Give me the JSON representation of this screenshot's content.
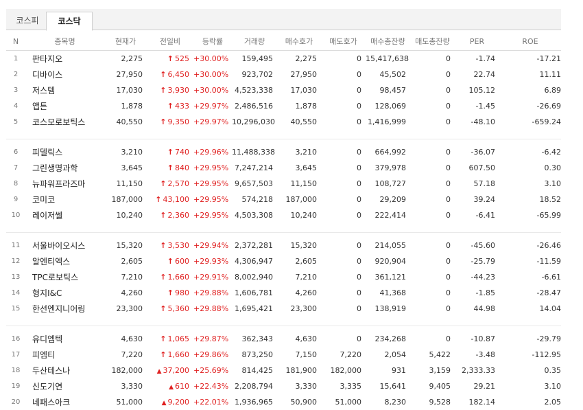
{
  "tabs": [
    {
      "label": "코스피"
    },
    {
      "label": "코스닥"
    }
  ],
  "columns": [
    "N",
    "종목명",
    "현재가",
    "전일비",
    "등락률",
    "거래량",
    "매수호가",
    "매도호가",
    "매수총잔량",
    "매도총잔량",
    "PER",
    "ROE"
  ],
  "rows": [
    {
      "n": "1",
      "name": "판타지오",
      "price": "2,275",
      "arrow": "up-arrow",
      "change": "525",
      "rate": "+30.00%",
      "volume": "159,495",
      "bid": "2,275",
      "ask": "0",
      "bid_total": "15,417,638",
      "ask_total": "0",
      "per": "-1.74",
      "roe": "-17.21"
    },
    {
      "n": "2",
      "name": "디바이스",
      "price": "27,950",
      "arrow": "up-arrow",
      "change": "6,450",
      "rate": "+30.00%",
      "volume": "923,702",
      "bid": "27,950",
      "ask": "0",
      "bid_total": "45,502",
      "ask_total": "0",
      "per": "22.74",
      "roe": "11.11"
    },
    {
      "n": "3",
      "name": "저스템",
      "price": "17,030",
      "arrow": "up-arrow",
      "change": "3,930",
      "rate": "+30.00%",
      "volume": "4,523,338",
      "bid": "17,030",
      "ask": "0",
      "bid_total": "98,457",
      "ask_total": "0",
      "per": "105.12",
      "roe": "6.89"
    },
    {
      "n": "4",
      "name": "앱튼",
      "price": "1,878",
      "arrow": "up-arrow",
      "change": "433",
      "rate": "+29.97%",
      "volume": "2,486,516",
      "bid": "1,878",
      "ask": "0",
      "bid_total": "128,069",
      "ask_total": "0",
      "per": "-1.45",
      "roe": "-26.69"
    },
    {
      "n": "5",
      "name": "코스모로보틱스",
      "price": "40,550",
      "arrow": "up-arrow",
      "change": "9,350",
      "rate": "+29.97%",
      "volume": "10,296,030",
      "bid": "40,550",
      "ask": "0",
      "bid_total": "1,416,999",
      "ask_total": "0",
      "per": "-48.10",
      "roe": "-659.24"
    },
    {
      "n": "6",
      "name": "피델릭스",
      "price": "3,210",
      "arrow": "up-arrow",
      "change": "740",
      "rate": "+29.96%",
      "volume": "11,488,338",
      "bid": "3,210",
      "ask": "0",
      "bid_total": "664,992",
      "ask_total": "0",
      "per": "-36.07",
      "roe": "-6.42"
    },
    {
      "n": "7",
      "name": "그린생명과학",
      "price": "3,645",
      "arrow": "up-arrow",
      "change": "840",
      "rate": "+29.95%",
      "volume": "7,247,214",
      "bid": "3,645",
      "ask": "0",
      "bid_total": "379,978",
      "ask_total": "0",
      "per": "607.50",
      "roe": "0.30"
    },
    {
      "n": "8",
      "name": "뉴파워프라즈마",
      "price": "11,150",
      "arrow": "up-arrow",
      "change": "2,570",
      "rate": "+29.95%",
      "volume": "9,657,503",
      "bid": "11,150",
      "ask": "0",
      "bid_total": "108,727",
      "ask_total": "0",
      "per": "57.18",
      "roe": "3.10"
    },
    {
      "n": "9",
      "name": "코미코",
      "price": "187,000",
      "arrow": "up-arrow",
      "change": "43,100",
      "rate": "+29.95%",
      "volume": "574,218",
      "bid": "187,000",
      "ask": "0",
      "bid_total": "29,209",
      "ask_total": "0",
      "per": "39.24",
      "roe": "18.52"
    },
    {
      "n": "10",
      "name": "레이저쎌",
      "price": "10,240",
      "arrow": "up-arrow",
      "change": "2,360",
      "rate": "+29.95%",
      "volume": "4,503,308",
      "bid": "10,240",
      "ask": "0",
      "bid_total": "222,414",
      "ask_total": "0",
      "per": "-6.41",
      "roe": "-65.99"
    },
    {
      "n": "11",
      "name": "서울바이오시스",
      "price": "15,320",
      "arrow": "up-arrow",
      "change": "3,530",
      "rate": "+29.94%",
      "volume": "2,372,281",
      "bid": "15,320",
      "ask": "0",
      "bid_total": "214,055",
      "ask_total": "0",
      "per": "-45.60",
      "roe": "-26.46"
    },
    {
      "n": "12",
      "name": "알엔티엑스",
      "price": "2,605",
      "arrow": "up-arrow",
      "change": "600",
      "rate": "+29.93%",
      "volume": "4,306,947",
      "bid": "2,605",
      "ask": "0",
      "bid_total": "920,904",
      "ask_total": "0",
      "per": "-25.79",
      "roe": "-11.59"
    },
    {
      "n": "13",
      "name": "TPC로보틱스",
      "price": "7,210",
      "arrow": "up-arrow",
      "change": "1,660",
      "rate": "+29.91%",
      "volume": "8,002,940",
      "bid": "7,210",
      "ask": "0",
      "bid_total": "361,121",
      "ask_total": "0",
      "per": "-44.23",
      "roe": "-6.61"
    },
    {
      "n": "14",
      "name": "형지I&C",
      "price": "4,260",
      "arrow": "up-arrow",
      "change": "980",
      "rate": "+29.88%",
      "volume": "1,606,781",
      "bid": "4,260",
      "ask": "0",
      "bid_total": "41,368",
      "ask_total": "0",
      "per": "-1.85",
      "roe": "-28.47"
    },
    {
      "n": "15",
      "name": "한선엔지니어링",
      "price": "23,300",
      "arrow": "up-arrow",
      "change": "5,360",
      "rate": "+29.88%",
      "volume": "1,695,421",
      "bid": "23,300",
      "ask": "0",
      "bid_total": "138,919",
      "ask_total": "0",
      "per": "44.98",
      "roe": "14.04"
    },
    {
      "n": "16",
      "name": "유디엠텍",
      "price": "4,630",
      "arrow": "up-arrow",
      "change": "1,065",
      "rate": "+29.87%",
      "volume": "362,343",
      "bid": "4,630",
      "ask": "0",
      "bid_total": "234,268",
      "ask_total": "0",
      "per": "-10.87",
      "roe": "-29.79"
    },
    {
      "n": "17",
      "name": "피엠티",
      "price": "7,220",
      "arrow": "up-arrow",
      "change": "1,660",
      "rate": "+29.86%",
      "volume": "873,250",
      "bid": "7,150",
      "ask": "7,220",
      "bid_total": "2,054",
      "ask_total": "5,422",
      "per": "-3.48",
      "roe": "-112.95"
    },
    {
      "n": "18",
      "name": "두산테스나",
      "price": "182,000",
      "arrow": "up-triangle",
      "change": "37,200",
      "rate": "+25.69%",
      "volume": "814,425",
      "bid": "181,900",
      "ask": "182,000",
      "bid_total": "931",
      "ask_total": "3,159",
      "per": "2,333.33",
      "roe": "0.35"
    },
    {
      "n": "19",
      "name": "신도기연",
      "price": "3,330",
      "arrow": "up-triangle",
      "change": "610",
      "rate": "+22.43%",
      "volume": "2,208,794",
      "bid": "3,330",
      "ask": "3,335",
      "bid_total": "15,641",
      "ask_total": "9,405",
      "per": "29.21",
      "roe": "3.10"
    },
    {
      "n": "20",
      "name": "네패스아크",
      "price": "51,000",
      "arrow": "up-triangle",
      "change": "9,200",
      "rate": "+22.01%",
      "volume": "1,936,965",
      "bid": "50,900",
      "ask": "51,000",
      "bid_total": "8,230",
      "ask_total": "9,528",
      "per": "182.14",
      "roe": "2.05"
    }
  ],
  "colors": {
    "up": "#e01f1f"
  }
}
